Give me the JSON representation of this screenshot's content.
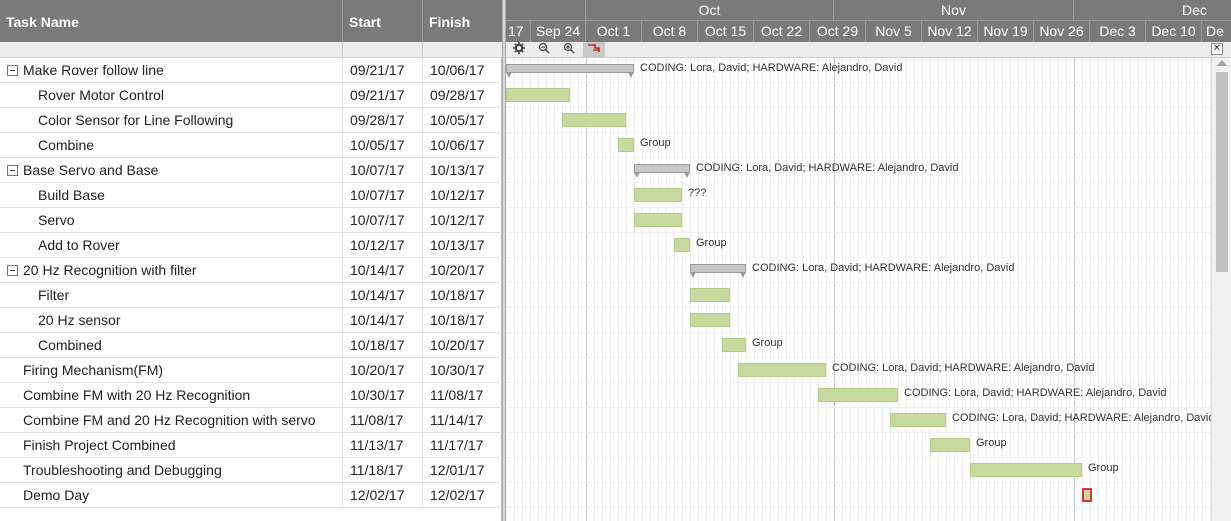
{
  "grid": {
    "headers": {
      "name": "Task Name",
      "start": "Start",
      "finish": "Finish"
    },
    "rows": [
      {
        "name": "Make Rover follow line",
        "start": "09/21/17",
        "finish": "10/06/17",
        "summary": true,
        "level": 0
      },
      {
        "name": "Rover Motor Control",
        "start": "09/21/17",
        "finish": "09/28/17",
        "summary": false,
        "level": 1
      },
      {
        "name": "Color Sensor for Line Following",
        "start": "09/28/17",
        "finish": "10/05/17",
        "summary": false,
        "level": 1
      },
      {
        "name": "Combine",
        "start": "10/05/17",
        "finish": "10/06/17",
        "summary": false,
        "level": 1
      },
      {
        "name": "Base Servo and Base",
        "start": "10/07/17",
        "finish": "10/13/17",
        "summary": true,
        "level": 0
      },
      {
        "name": "Build Base",
        "start": "10/07/17",
        "finish": "10/12/17",
        "summary": false,
        "level": 1
      },
      {
        "name": "Servo",
        "start": "10/07/17",
        "finish": "10/12/17",
        "summary": false,
        "level": 1
      },
      {
        "name": "Add to Rover",
        "start": "10/12/17",
        "finish": "10/13/17",
        "summary": false,
        "level": 1
      },
      {
        "name": "20 Hz Recognition with filter",
        "start": "10/14/17",
        "finish": "10/20/17",
        "summary": true,
        "level": 0
      },
      {
        "name": "Filter",
        "start": "10/14/17",
        "finish": "10/18/17",
        "summary": false,
        "level": 1
      },
      {
        "name": "20 Hz sensor",
        "start": "10/14/17",
        "finish": "10/18/17",
        "summary": false,
        "level": 1
      },
      {
        "name": "Combined",
        "start": "10/18/17",
        "finish": "10/20/17",
        "summary": false,
        "level": 1
      },
      {
        "name": "Firing Mechanism(FM)",
        "start": "10/20/17",
        "finish": "10/30/17",
        "summary": false,
        "level": 0
      },
      {
        "name": "Combine FM with 20 Hz Recognition",
        "start": "10/30/17",
        "finish": "11/08/17",
        "summary": false,
        "level": 0
      },
      {
        "name": "Combine FM and 20 Hz Recognition with servo",
        "start": "11/08/17",
        "finish": "11/14/17",
        "summary": false,
        "level": 0
      },
      {
        "name": "Finish Project Combined",
        "start": "11/13/17",
        "finish": "11/17/17",
        "summary": false,
        "level": 0
      },
      {
        "name": "Troubleshooting and Debugging",
        "start": "11/18/17",
        "finish": "12/01/17",
        "summary": false,
        "level": 0
      },
      {
        "name": "Demo Day",
        "start": "12/02/17",
        "finish": "12/02/17",
        "summary": false,
        "level": 0
      }
    ]
  },
  "timeline": {
    "months": [
      "Oct",
      "Nov",
      "Dec"
    ],
    "weeks": [
      "17",
      "Sep 24",
      "Oct 1",
      "Oct 8",
      "Oct 15",
      "Oct 22",
      "Oct 29",
      "Nov 5",
      "Nov 12",
      "Nov 19",
      "Nov 26",
      "Dec 3",
      "Dec 10",
      "De"
    ],
    "labels": [
      "CODING: Lora, David; HARDWARE: Alejandro, David",
      "",
      "",
      "Group",
      "CODING: Lora, David; HARDWARE: Alejandro, David",
      "???",
      "",
      "Group",
      "CODING: Lora, David; HARDWARE: Alejandro, David",
      "",
      "",
      "Group",
      "CODING: Lora, David; HARDWARE: Alejandro, David",
      "CODING: Lora, David; HARDWARE: Alejandro, David",
      "CODING: Lora, David; HARDWARE: Alejandro, David",
      "Group",
      "Group",
      ""
    ]
  },
  "toolbar": {
    "settings_icon": "gear-icon",
    "zoom_out_icon": "zoom-out-icon",
    "zoom_in_icon": "zoom-in-icon",
    "gantt_icon": "critical-path-icon",
    "close_symbol": "✕"
  },
  "colors": {
    "bar": "#c5da9c",
    "summary": "#c8c8c8",
    "header": "#7a7a7a",
    "selected_border": "#dd3333"
  }
}
